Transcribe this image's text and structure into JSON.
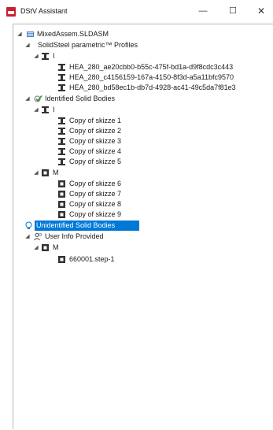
{
  "window": {
    "title": "DStV Assistant",
    "controls": {
      "minimize": "—",
      "maximize": "☐",
      "close": "✕"
    }
  },
  "tree": {
    "root": "MixedAssem.SLDASM",
    "profiles_group": "SolidSteel parametric™ Profiles",
    "profiles_beam": "I",
    "profiles": [
      "HEA_280_ae20cbb0-b55c-475f-bd1a-d9f8cdc3c443",
      "HEA_280_c4156159-167a-4150-8f3d-a5a11bfc9570",
      "HEA_280_bd58ec1b-db7d-4928-ac41-49c5da7f81e3"
    ],
    "identified": "Identified Solid Bodies",
    "identified_i": "I",
    "identified_i_items": [
      "Copy of skizze 1",
      "Copy of skizze 2",
      "Copy of skizze 3",
      "Copy of skizze 4",
      "Copy of skizze 5"
    ],
    "identified_m": "M",
    "identified_m_items": [
      "Copy of skizze 6",
      "Copy of skizze 7",
      "Copy of skizze 8",
      "Copy of skizze 9"
    ],
    "unidentified": "Unidentified Solid Bodies",
    "user_info": "User Info Provided",
    "user_info_m": "M",
    "user_info_items": [
      "660001.step-1"
    ]
  },
  "colors": {
    "selection": "#0078d7",
    "app_icon": "#c8202f"
  }
}
